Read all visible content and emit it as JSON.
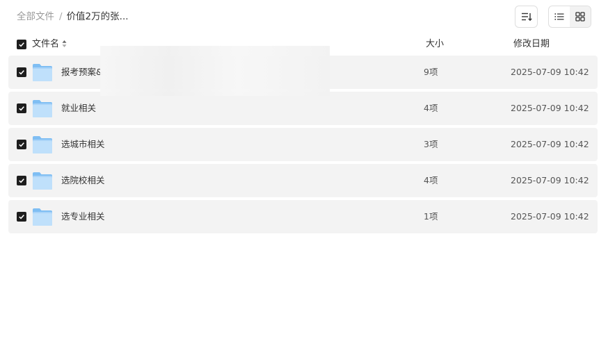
{
  "breadcrumb": {
    "root": "全部文件",
    "separator": "/",
    "current": "价值2万的张..."
  },
  "toolbar": {
    "sort_icon": "sort-lines-icon",
    "list_view_icon": "list-view-icon",
    "grid_view_icon": "grid-view-icon",
    "active_view": "list"
  },
  "table": {
    "headers": {
      "name": "文件名",
      "size": "大小",
      "date": "修改日期"
    },
    "rows": [
      {
        "name": "报考预案&",
        "size": "9项",
        "date": "2025-07-09 10:42",
        "checked": true
      },
      {
        "name": "就业相关",
        "size": "4项",
        "date": "2025-07-09 10:42",
        "checked": true
      },
      {
        "name": "选城市相关",
        "size": "3项",
        "date": "2025-07-09 10:42",
        "checked": true
      },
      {
        "name": "选院校相关",
        "size": "4项",
        "date": "2025-07-09 10:42",
        "checked": true
      },
      {
        "name": "选专业相关",
        "size": "1项",
        "date": "2025-07-09 10:42",
        "checked": true
      }
    ]
  },
  "colors": {
    "row_background": "#f3f3f3",
    "checkbox": "#1e1e1e",
    "folder_light": "#bfe0fb",
    "folder_dark": "#7fbef3"
  }
}
